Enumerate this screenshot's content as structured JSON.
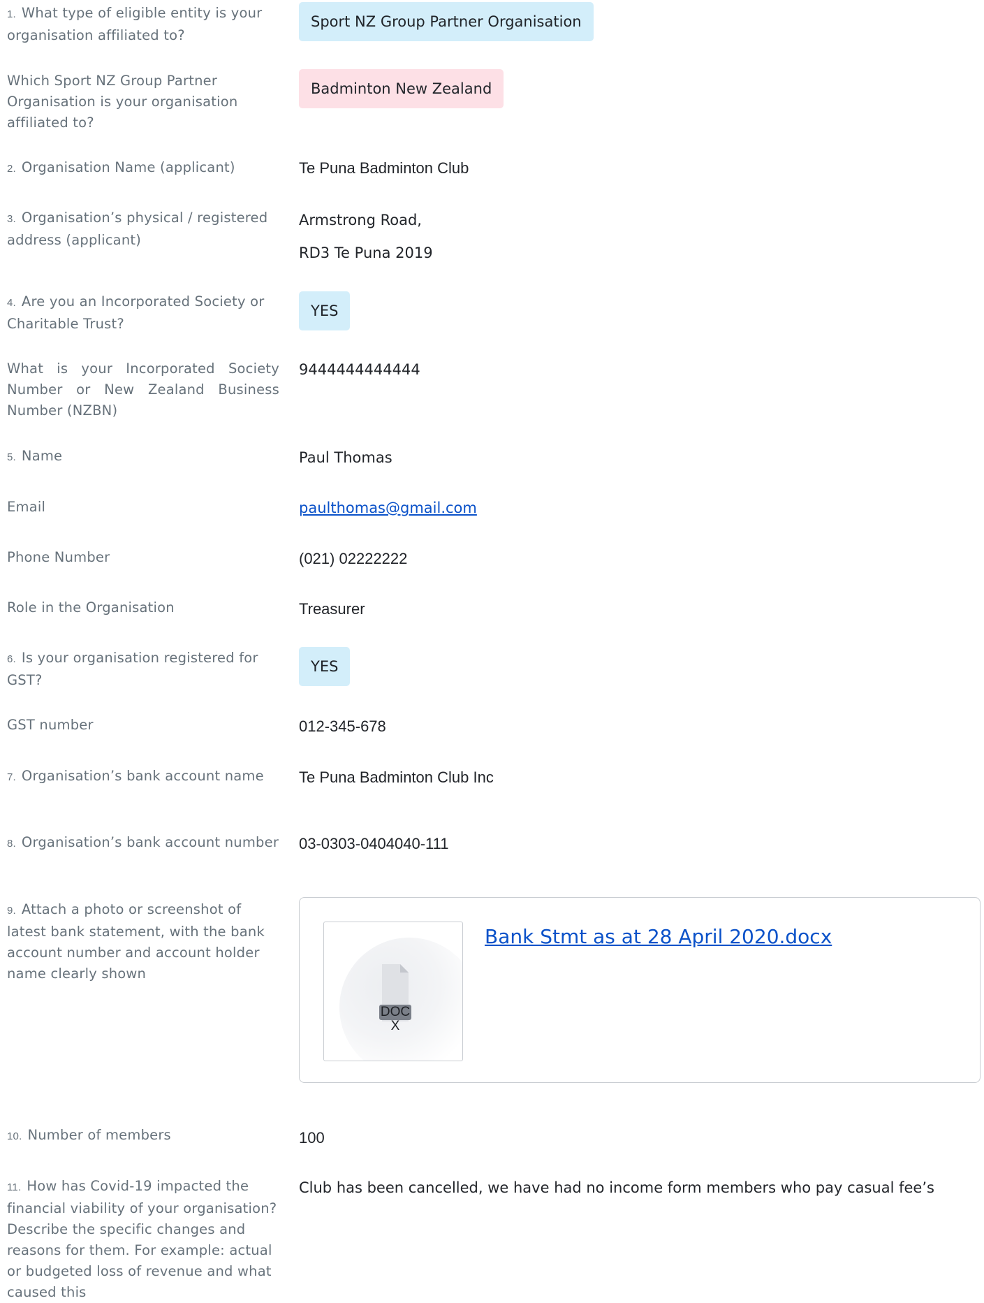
{
  "fields": [
    {
      "num": "1.",
      "label": "What type of eligible entity is your organisation affiliated to?",
      "value": "Sport NZ Group Partner Organisation"
    },
    {
      "num": "",
      "label": "Which Sport NZ Group Partner Organisation is your organisation affiliated to?",
      "value": "Badminton New Zealand"
    },
    {
      "num": "2.",
      "label": "Organisation Name (applicant)",
      "value": "Te Puna Badminton Club"
    },
    {
      "num": "3.",
      "label": "Organisation’s physical / registered address (applicant)",
      "value_line1": "Armstrong Road,",
      "value_line2": "RD3 Te Puna 2019"
    },
    {
      "num": "4.",
      "label": "Are you an Incorporated Society or Charitable Trust?",
      "value": "YES"
    },
    {
      "num": "",
      "label": "What is your Incorporated Society Number or New Zealand Business Number (NZBN)",
      "value": "9444444444444"
    },
    {
      "num": "5.",
      "label": "Name",
      "value": "Paul Thomas"
    },
    {
      "num": "",
      "label": "Email",
      "value": "paulthomas@gmail.com"
    },
    {
      "num": "",
      "label": "Phone Number",
      "value": "(021) 02222222"
    },
    {
      "num": "",
      "label": "Role in the Organisation",
      "value": "Treasurer"
    },
    {
      "num": "6.",
      "label": "Is your organisation registered for GST?",
      "value": "YES"
    },
    {
      "num": "",
      "label": "GST number",
      "value": "012-345-678"
    },
    {
      "num": "7.",
      "label": "Organisation’s bank account name",
      "value": "Te Puna Badminton Club Inc"
    },
    {
      "num": "8.",
      "label": "Organisation’s bank account number",
      "value": "03-0303-0404040-111"
    },
    {
      "num": "9.",
      "label": "Attach a photo or screenshot of latest bank statement, with the bank account number and account holder name clearly shown",
      "file_type": "DOCX",
      "file_name": "Bank Stmt as at 28 April 2020.docx"
    },
    {
      "num": "10.",
      "label": "Number of members",
      "value": "100"
    },
    {
      "num": "11.",
      "label": "How has Covid-19 impacted the financial viability of your organisation? Describe the specific changes and reasons for them. For example: actual or budgeted loss of revenue and what caused this",
      "value": "Club has been cancelled, we have had no income form members who pay casual fee’s"
    }
  ],
  "colors": {
    "badge_blue": "#d3eefa",
    "badge_pink": "#fde0e6",
    "link": "#0b52c9",
    "label": "#67727b",
    "value": "#22252a"
  },
  "icons": {
    "attachment": "docx-file-icon"
  }
}
